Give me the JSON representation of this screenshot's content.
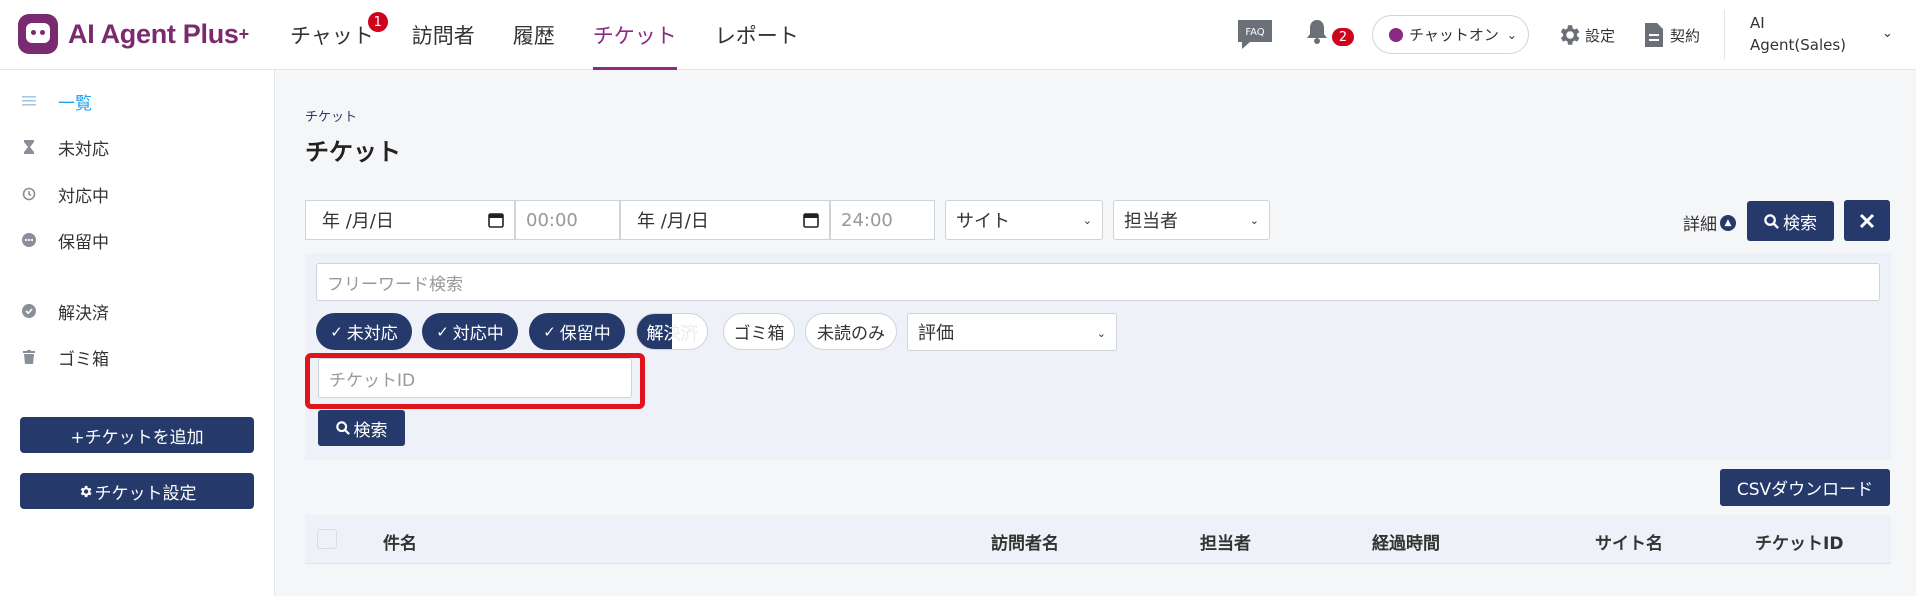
{
  "app": {
    "brand": "AI Agent Plus",
    "brand_mark": "+"
  },
  "nav": [
    {
      "label": "チャット",
      "badge": "1"
    },
    {
      "label": "訪問者"
    },
    {
      "label": "履歴"
    },
    {
      "label": "チケット",
      "active": true
    },
    {
      "label": "レポート"
    }
  ],
  "header": {
    "faq_label": "FAQ",
    "bell_badge": "2",
    "chat_status": "チャットオン",
    "settings_label": "設定",
    "contract_label": "契約",
    "user_line1": "AI",
    "user_line2": "Agent(Sales)"
  },
  "sidebar": {
    "items": [
      {
        "label": "一覧",
        "active": true
      },
      {
        "label": "未対応"
      },
      {
        "label": "対応中"
      },
      {
        "label": "保留中"
      },
      {
        "label": "解決済"
      },
      {
        "label": "ゴミ箱"
      }
    ],
    "add_ticket": "+チケットを追加",
    "ticket_settings": "チケット設定"
  },
  "page": {
    "breadcrumb": "チケット",
    "title": "チケット"
  },
  "filters": {
    "date_from": "年 /月/日",
    "time_from": "00:00",
    "date_to": "年 /月/日",
    "time_to": "24:00",
    "site": "サイト",
    "assignee": "担当者",
    "detail": "詳細",
    "search": "検索",
    "freeword_placeholder": "フリーワード検索",
    "chips": [
      {
        "label": "未対応",
        "state": "on"
      },
      {
        "label": "対応中",
        "state": "on"
      },
      {
        "label": "保留中",
        "state": "on"
      },
      {
        "label": "解決済",
        "state": "half"
      },
      {
        "label": "ゴミ箱",
        "state": "off"
      },
      {
        "label": "未読のみ",
        "state": "off"
      }
    ],
    "rating": "評価",
    "ticket_id_placeholder": "チケットID",
    "panel_search": "検索"
  },
  "csv_download": "CSVダウンロード",
  "table": {
    "columns": [
      "件名",
      "訪問者名",
      "担当者",
      "経過時間",
      "サイト名",
      "チケットID"
    ]
  },
  "colors": {
    "brand": "#7a2a6f",
    "accent": "#8b2a82",
    "primary": "#253a6b",
    "highlight": "#e0141b"
  }
}
